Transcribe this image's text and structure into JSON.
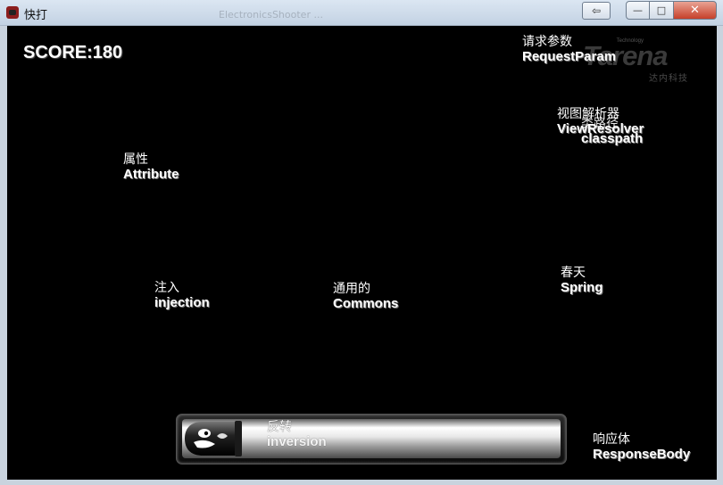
{
  "window": {
    "title": "快打",
    "ghost_title": "ElectronicsShooter  ...",
    "restore_glyph": "⇦",
    "min_glyph": "—",
    "max_glyph": "□",
    "close_glyph": "✕"
  },
  "game": {
    "score_label": "SCORE:180",
    "logo": {
      "tech": "Technology",
      "word": "Tarena",
      "sub": "达内科技"
    },
    "falling_words": [
      {
        "cn": "请求参数",
        "en": "RequestParam"
      },
      {
        "cn": "视图解析器",
        "en": "ViewResolver"
      },
      {
        "cn": "类路径",
        "en": "classpath"
      },
      {
        "cn": "属性",
        "en": "Attribute"
      },
      {
        "cn": "注入",
        "en": "injection"
      },
      {
        "cn": "通用的",
        "en": "Commons"
      },
      {
        "cn": "春天",
        "en": "Spring"
      },
      {
        "cn": "响应体",
        "en": "ResponseBody"
      }
    ],
    "input_bar": {
      "cn": "反转",
      "en": "inversion",
      "icon": "bullet-icon"
    }
  }
}
